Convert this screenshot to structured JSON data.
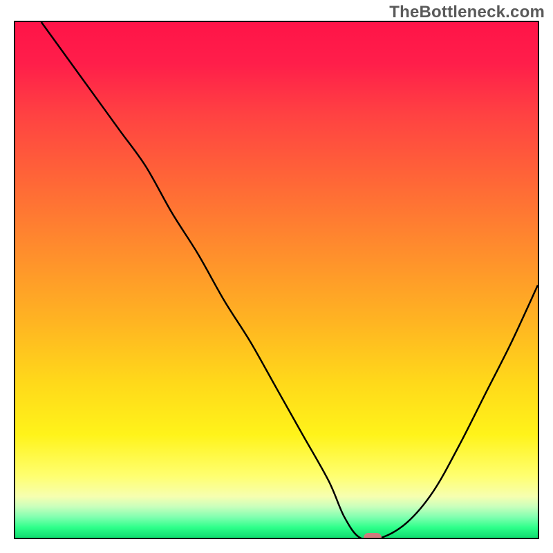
{
  "watermark": "TheBottleneck.com",
  "chart_data": {
    "type": "line",
    "title": "",
    "xlabel": "",
    "ylabel": "",
    "xlim": [
      0,
      100
    ],
    "ylim": [
      0,
      100
    ],
    "grid": false,
    "legend": false,
    "series": [
      {
        "name": "bottleneck-curve",
        "x": [
          5,
          10,
          15,
          20,
          25,
          30,
          35,
          40,
          45,
          50,
          55,
          60,
          63,
          66,
          70,
          75,
          80,
          85,
          90,
          95,
          100
        ],
        "y": [
          100,
          93,
          86,
          79,
          72,
          63,
          55,
          46,
          38,
          29,
          20,
          11,
          4,
          0,
          0,
          3,
          9,
          18,
          28,
          38,
          49
        ]
      }
    ],
    "annotations": [
      {
        "name": "optimal-marker",
        "x": 68,
        "y": 0,
        "shape": "rounded-rect",
        "color": "#d07a7c"
      }
    ],
    "background": "vertical-gradient red→green"
  },
  "style": {
    "curve_stroke": "#000000",
    "marker_color": "#d07a7c"
  }
}
